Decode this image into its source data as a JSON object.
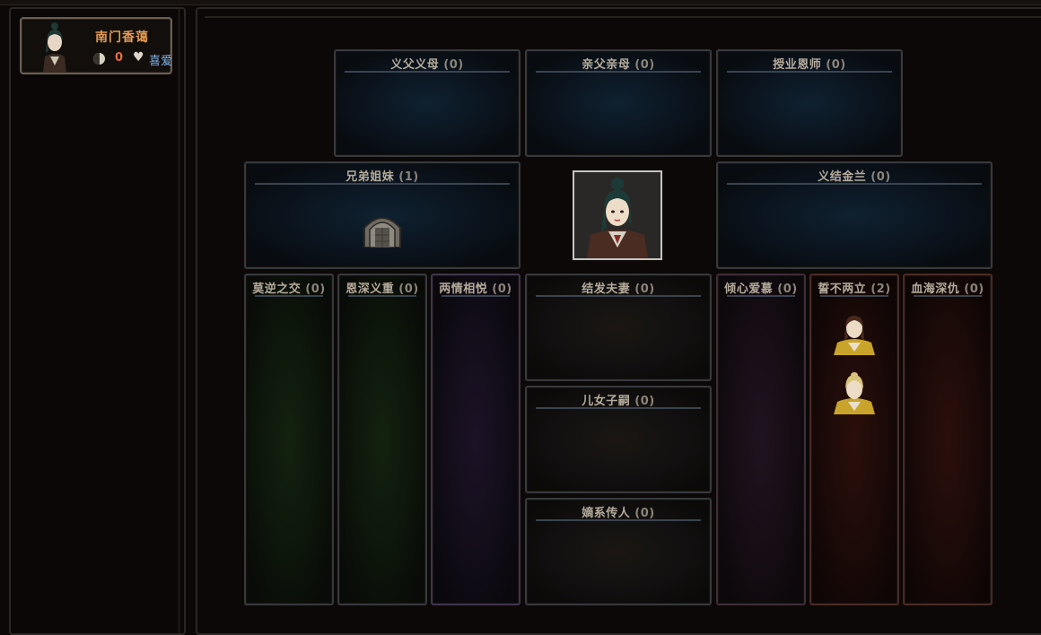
{
  "character": {
    "name": "南门香蔼",
    "stat_value": "0",
    "favor_label": "喜爱"
  },
  "relations": {
    "adoptive_parents": {
      "label": "义父义母",
      "count": "(0)"
    },
    "birth_parents": {
      "label": "亲父亲母",
      "count": "(0)"
    },
    "mentor": {
      "label": "授业恩师",
      "count": "(0)"
    },
    "siblings": {
      "label": "兄弟姐妹",
      "count": "(1)"
    },
    "sworn": {
      "label": "义结金兰",
      "count": "(0)"
    },
    "close_friends": {
      "label": "莫逆之交",
      "count": "(0)"
    },
    "deep_gratitude": {
      "label": "恩深义重",
      "count": "(0)"
    },
    "mutual_love": {
      "label": "两情相悦",
      "count": "(0)"
    },
    "spouse": {
      "label": "结发夫妻",
      "count": "(0)"
    },
    "children": {
      "label": "儿女子嗣",
      "count": "(0)"
    },
    "heirs": {
      "label": "嫡系传人",
      "count": "(0)"
    },
    "admiration": {
      "label": "倾心爱慕",
      "count": "(0)"
    },
    "irreconcilable": {
      "label": "誓不两立",
      "count": "(2)"
    },
    "blood_feud": {
      "label": "血海深仇",
      "count": "(0)"
    }
  },
  "icons": {
    "stat": "yin-yang-icon",
    "favor": "heart-icon",
    "sibling": "gate-icon"
  },
  "colors": {
    "name": "#e39a55",
    "stat_value": "#e26b3c",
    "favor": "#7fb3ea"
  }
}
